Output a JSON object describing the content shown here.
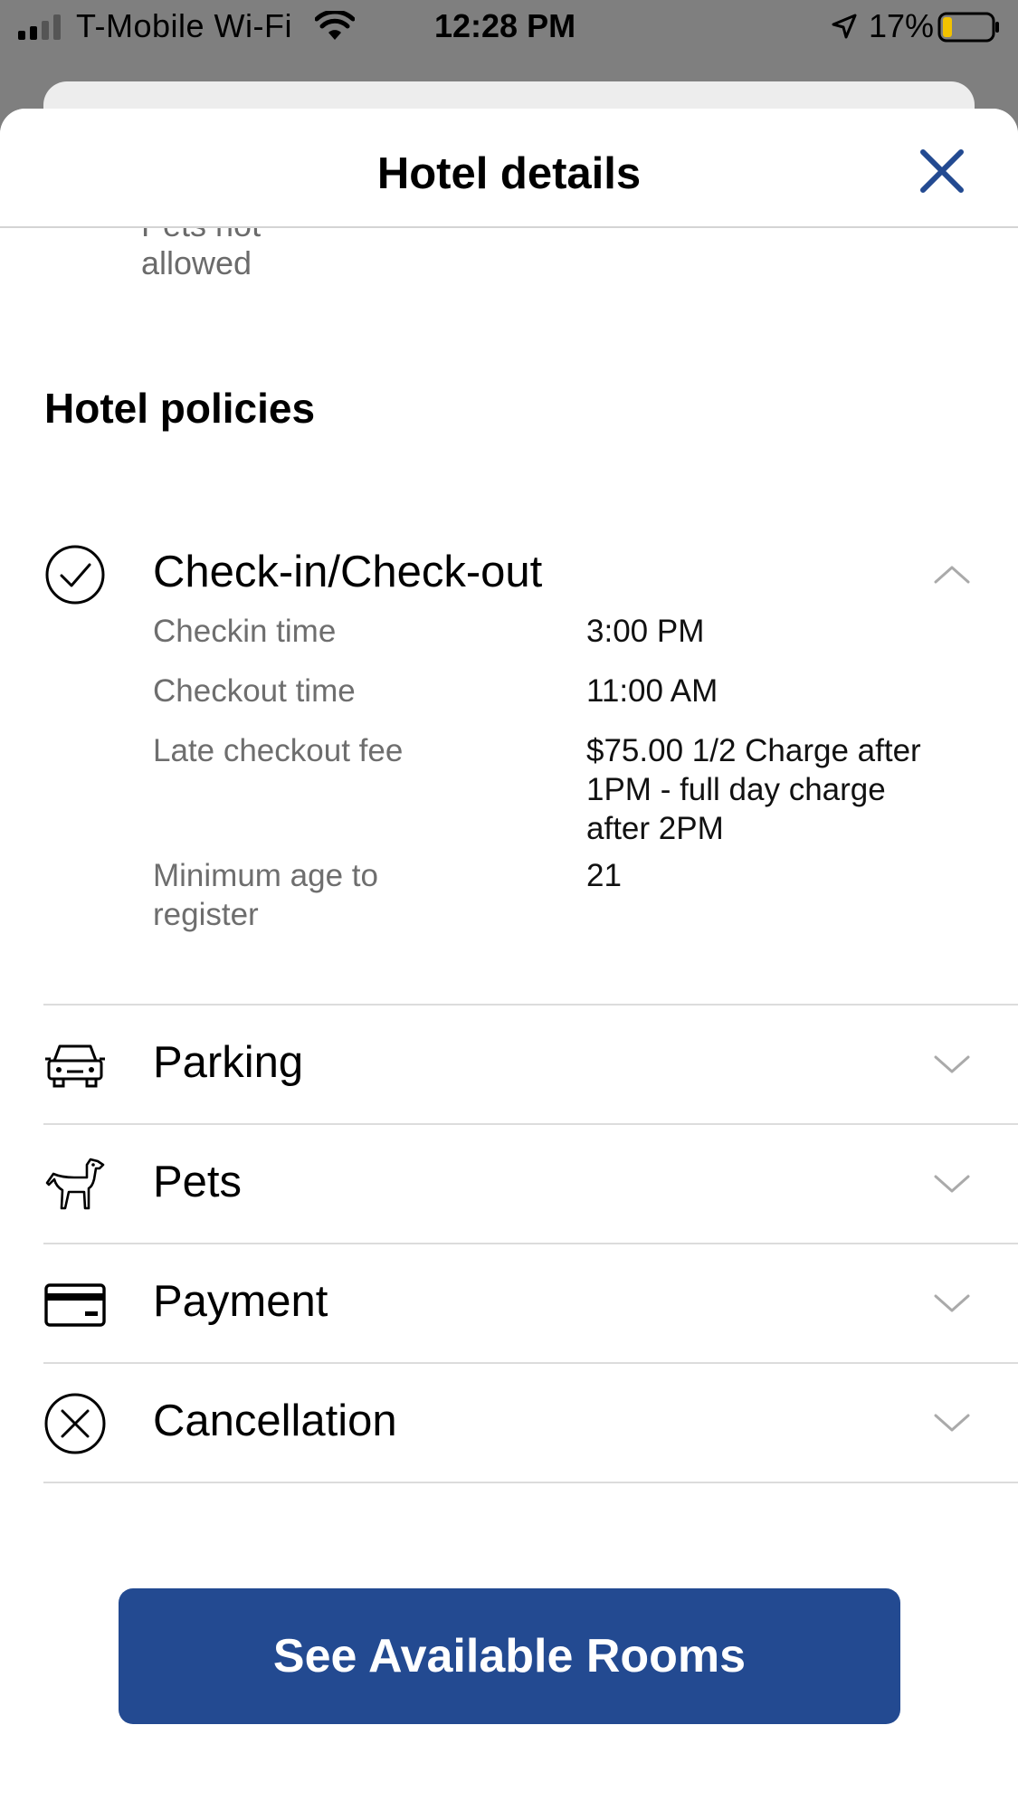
{
  "status_bar": {
    "carrier": "T-Mobile Wi-Fi",
    "time": "12:28 PM",
    "battery_percent": "17%",
    "icons": [
      "signal-icon",
      "wifi-icon",
      "location-arrow-icon",
      "battery-icon"
    ]
  },
  "sheet": {
    "title": "Hotel details",
    "close_icon": "close-icon",
    "accent_color": "#234a91"
  },
  "partial_text": "Pets not allowed",
  "policies": {
    "section_title": "Hotel policies",
    "items": [
      {
        "label": "Check-in/Check-out",
        "icon": "check-circle-icon",
        "expanded": true,
        "details": [
          {
            "key": "Checkin time",
            "value": "3:00 PM"
          },
          {
            "key": "Checkout time",
            "value": "11:00 AM"
          },
          {
            "key": "Late checkout fee",
            "value": "$75.00 1/2 Charge after 1PM - full day charge after 2PM"
          },
          {
            "key": "Minimum age to register",
            "value": "21"
          }
        ]
      },
      {
        "label": "Parking",
        "icon": "car-icon",
        "expanded": false
      },
      {
        "label": "Pets",
        "icon": "dog-icon",
        "expanded": false
      },
      {
        "label": "Payment",
        "icon": "credit-card-icon",
        "expanded": false
      },
      {
        "label": "Cancellation",
        "icon": "cancel-circle-icon",
        "expanded": false
      }
    ]
  },
  "cta": {
    "label": "See Available Rooms"
  }
}
